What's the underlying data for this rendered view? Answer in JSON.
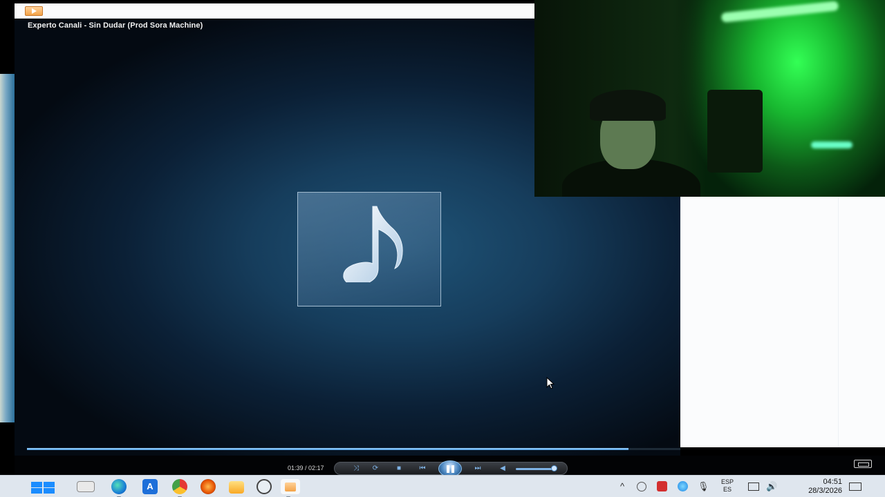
{
  "player": {
    "now_playing": "Experto Canali - Sin Dudar (Prod Sora Machine)",
    "time": "01:39 / 02:17",
    "progress_fraction": 0.9202,
    "volume_fraction": 0.9,
    "accent_color": "#4d9ce0"
  },
  "taskbar": {
    "apps": [
      "windows-start",
      "task-view",
      "edge",
      "word",
      "chrome",
      "git",
      "file-explorer",
      "android-studio",
      "media-player"
    ],
    "tray": {
      "language_top": "ESP",
      "language_bottom": "ES",
      "time": "04:51",
      "date": "28/3/2026"
    }
  }
}
